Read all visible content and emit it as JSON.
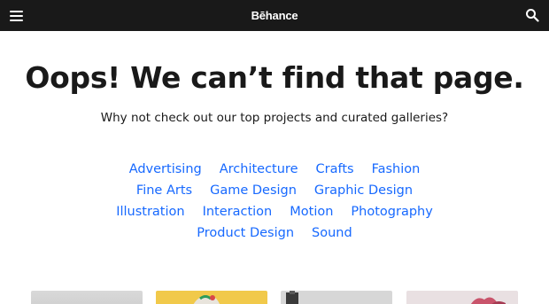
{
  "header": {
    "logo": "Bēhance",
    "menu_icon": "hamburger-menu-icon",
    "search_icon": "search-icon",
    "background": "#191919"
  },
  "error": {
    "headline": "Oops! We can’t find that page.",
    "subline": "Why not check out our top projects and curated galleries?"
  },
  "categories": {
    "link_color": "#1769ff",
    "rows": [
      [
        "Advertising",
        "Architecture",
        "Crafts",
        "Fashion"
      ],
      [
        "Fine Arts",
        "Game Design",
        "Graphic Design"
      ],
      [
        "Illustration",
        "Interaction",
        "Motion",
        "Photography"
      ],
      [
        "Product Design",
        "Sound"
      ]
    ]
  },
  "gallery": {
    "thumbnail_colors": [
      "#d6d6d6",
      "#f1c94a",
      "#d7d7d7",
      "#e9e0e2"
    ]
  }
}
